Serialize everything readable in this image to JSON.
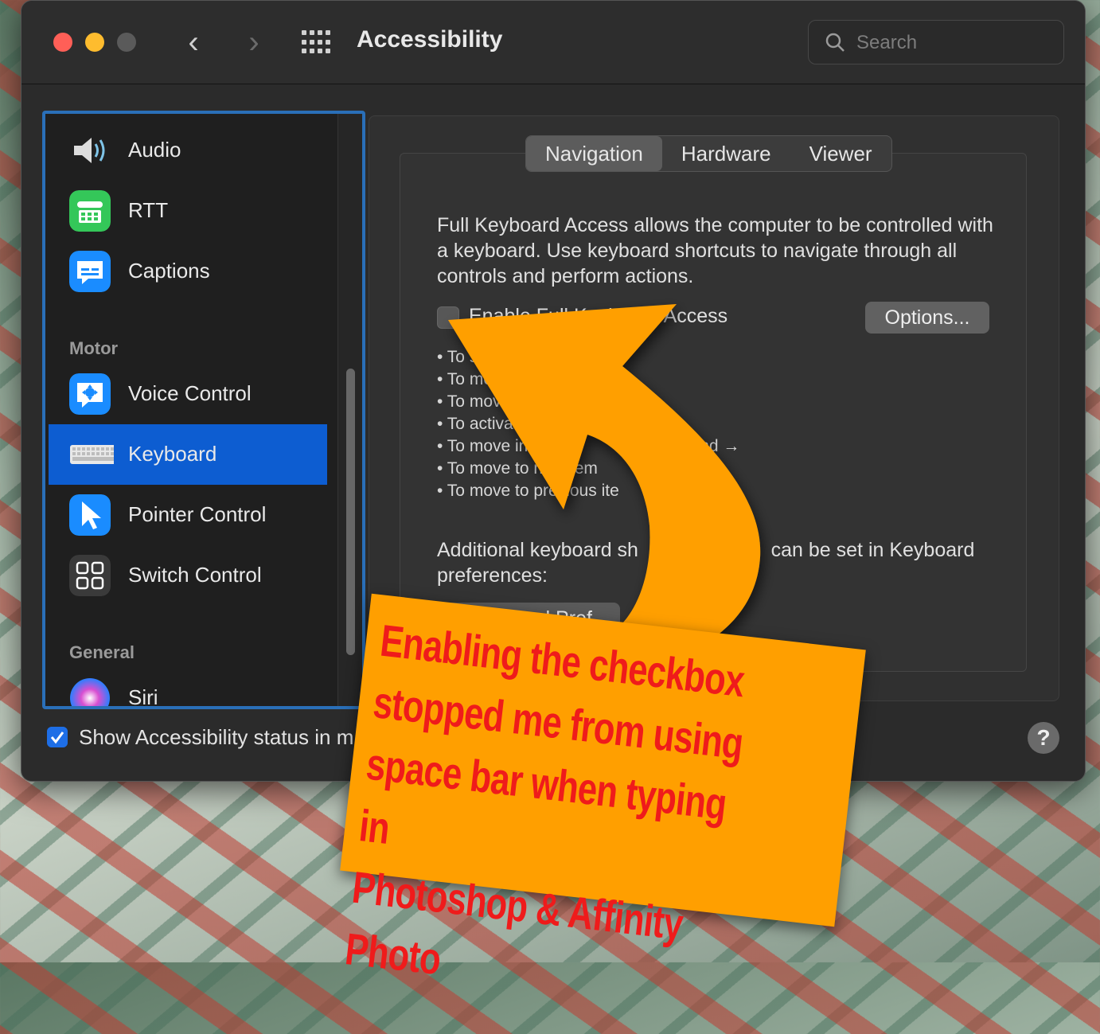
{
  "window": {
    "title": "Accessibility",
    "search_placeholder": "Search",
    "back_glyph": "‹",
    "forward_glyph": "›"
  },
  "sidebar": {
    "items_top": [
      {
        "label": "Audio",
        "icon": "speaker-icon"
      },
      {
        "label": "RTT",
        "icon": "tty-icon"
      },
      {
        "label": "Captions",
        "icon": "captions-icon"
      }
    ],
    "section_motor": "Motor",
    "items_motor": [
      {
        "label": "Voice Control",
        "icon": "voice-control-icon"
      },
      {
        "label": "Keyboard",
        "icon": "keyboard-icon",
        "selected": true
      },
      {
        "label": "Pointer Control",
        "icon": "pointer-icon"
      },
      {
        "label": "Switch Control",
        "icon": "switch-control-icon"
      }
    ],
    "section_general": "General",
    "items_general": [
      {
        "label": "Siri",
        "icon": "siri-icon"
      }
    ]
  },
  "footer": {
    "show_status_label": "Show Accessibility status in m",
    "show_status_checked": true,
    "help": "?"
  },
  "tabs": [
    "Navigation",
    "Hardware",
    "Viewer"
  ],
  "active_tab": "Navigation",
  "panel": {
    "description": "Full Keyboard Access allows the computer to be controlled with a keyboard. Use keyboard shortcuts to navigate through all controls and perform actions.",
    "enable_label": "Enable Full Keyboard Access",
    "enable_checked": false,
    "options_button": "Options...",
    "bullets": [
      "• To s",
      "• To mo",
      "• To move",
      "• To activat",
      "• To move in                                   and →",
      "• To move to n     item",
      "• To move to previous ite"
    ],
    "additional": "Additional keyboard sh                        can be set in Keyboard preferences:",
    "keyboard_prefs_button": "Keyboard Pref"
  },
  "annotation": {
    "text": "Enabling the checkbox\nstopped me from using\nspace bar when typing in\nPhotoshop & Affinity Photo",
    "note_color": "#ff9f00",
    "text_color": "#ef1b1b"
  }
}
